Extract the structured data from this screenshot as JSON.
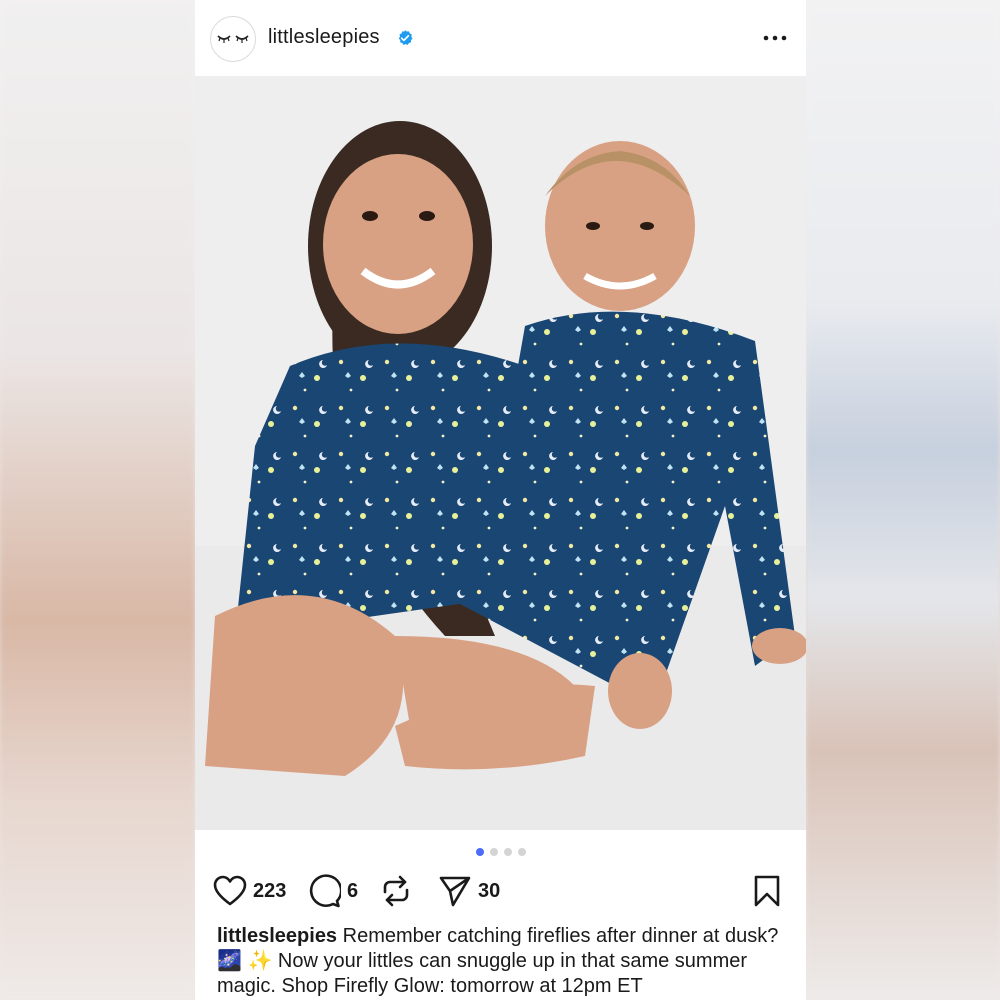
{
  "post": {
    "username": "littlesleepies",
    "verified": true,
    "image_alt": "Two children smiling in matching navy firefly-print pajamas",
    "carousel": {
      "current": 1,
      "total": 4
    },
    "actions": {
      "likes": "223",
      "comments": "6",
      "shares": "30"
    },
    "caption": {
      "user": "littlesleepies",
      "text": "Remember catching fireflies after dinner at dusk? 🌌 ✨ Now your littles can snuggle up in that same summer magic. Shop Firefly Glow: tomorrow at 12pm ET"
    }
  },
  "icons": {
    "avatar": "sleepy-eyes-logo",
    "verified": "verified-badge-icon",
    "more": "more-options-icon",
    "like": "heart-icon",
    "comment": "comment-icon",
    "repost": "repost-icon",
    "share": "send-icon",
    "save": "bookmark-icon"
  },
  "colors": {
    "verified_blue": "#1d9bf0",
    "carousel_active": "#4a6cf7",
    "pajama_navy": "#1a4673"
  }
}
